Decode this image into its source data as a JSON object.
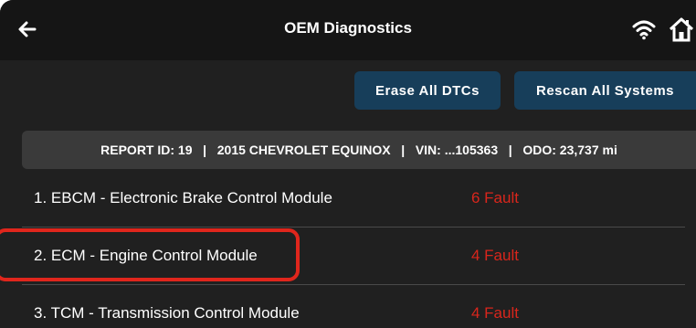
{
  "header": {
    "title": "OEM Diagnostics",
    "back_icon": "arrow-left-icon",
    "wifi_icon": "wifi-icon",
    "home_icon": "home-icon"
  },
  "actions": {
    "erase_label": "Erase All DTCs",
    "rescan_label": "Rescan All Systems"
  },
  "report": {
    "text": "REPORT ID: 19   |   2015 CHEVROLET EQUINOX   |   VIN: ...105363   |   ODO: 23,737 mi"
  },
  "modules": [
    {
      "name": "1. EBCM - Electronic Brake Control Module",
      "faults": "6 Fault"
    },
    {
      "name": "2. ECM - Engine Control Module",
      "faults": "4 Fault"
    },
    {
      "name": "3. TCM - Transmission Control Module",
      "faults": "4 Fault"
    }
  ],
  "colors": {
    "background": "#202020",
    "topbar": "#151515",
    "button": "#173e5a",
    "report_bar": "#3a3a3a",
    "fault_text": "#d9261c",
    "highlight": "#e0261c"
  }
}
